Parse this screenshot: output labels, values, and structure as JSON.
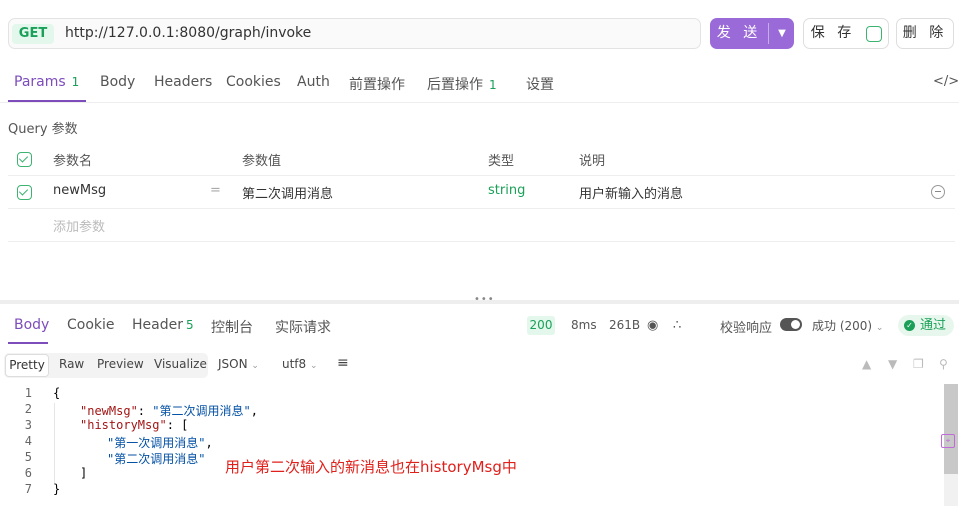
{
  "request": {
    "method": "GET",
    "url": "http://127.0.0.1:8080/graph/invoke",
    "send_label": "发 送",
    "save_label": "保 存",
    "delete_label": "删 除"
  },
  "request_tabs": [
    {
      "label": "Params",
      "count": "1"
    },
    {
      "label": "Body"
    },
    {
      "label": "Headers"
    },
    {
      "label": "Cookies"
    },
    {
      "label": "Auth"
    },
    {
      "label": "前置操作"
    },
    {
      "label": "后置操作",
      "count": "1"
    },
    {
      "label": "设置"
    }
  ],
  "query": {
    "title": "Query 参数",
    "headers": {
      "name": "参数名",
      "value": "参数值",
      "type": "类型",
      "desc": "说明"
    },
    "rows": [
      {
        "name": "newMsg",
        "eq": "=",
        "value": "第二次调用消息",
        "type": "string",
        "desc": "用户新输入的消息"
      }
    ],
    "add_placeholder": "添加参数"
  },
  "response_tabs": [
    {
      "label": "Body"
    },
    {
      "label": "Cookie"
    },
    {
      "label": "Header",
      "count": "5"
    },
    {
      "label": "控制台"
    },
    {
      "label": "实际请求"
    }
  ],
  "response_meta": {
    "status": "200",
    "time": "8ms",
    "size": "261B",
    "validate_label": "校验响应",
    "success_label": "成功 (200)",
    "pass_label": "通过"
  },
  "format": {
    "modes": [
      "Pretty",
      "Raw",
      "Preview",
      "Visualize"
    ],
    "lang": "JSON",
    "encoding": "utf8"
  },
  "code": {
    "line_numbers": [
      "1",
      "2",
      "3",
      "4",
      "5",
      "6",
      "7"
    ],
    "open_brace": "{",
    "key1": "\"newMsg\"",
    "val1": "\"第二次调用消息\"",
    "key2": "\"historyMsg\"",
    "hist1": "\"第一次调用消息\"",
    "hist2": "\"第二次调用消息\"",
    "close_bracket": "]",
    "close_brace": "}"
  },
  "annotation": "用户第二次输入的新消息也在historyMsg中",
  "colors": {
    "accent": "#7c4dbb",
    "send_button": "#9a6bd8",
    "success": "#1aa058",
    "annotation": "#e0201b"
  }
}
